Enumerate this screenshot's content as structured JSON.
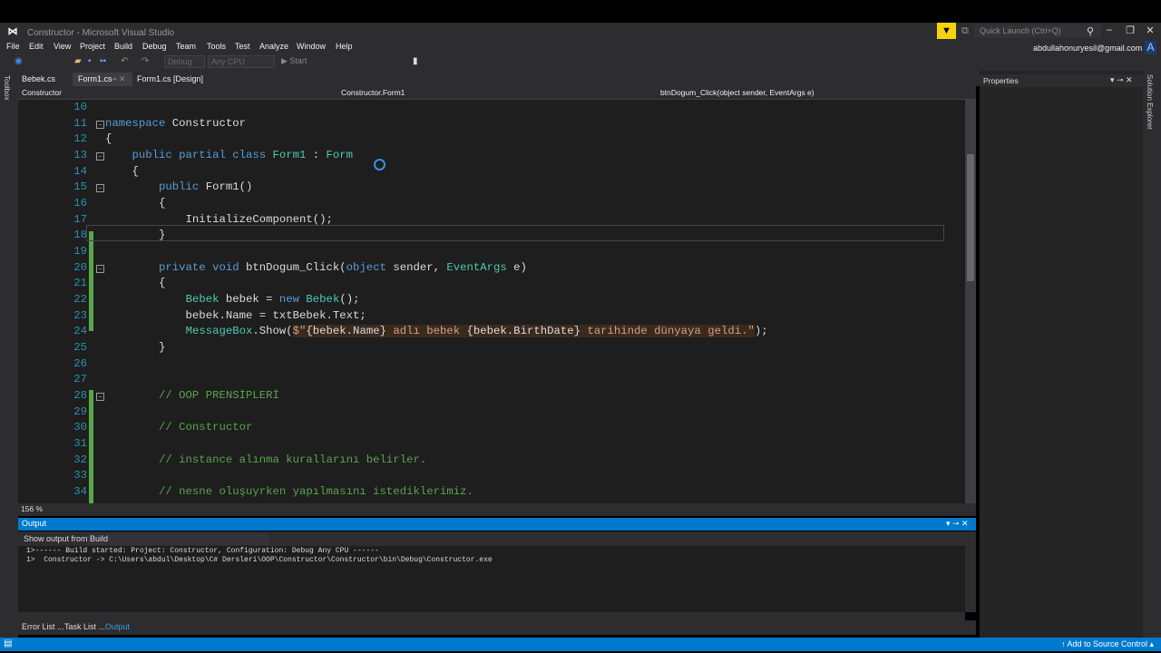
{
  "window": {
    "title": "Constructor - Microsoft Visual Studio",
    "quick_launch": "Quick Launch (Ctrl+Q)",
    "account": "abdullahonuryesil@gmail.com",
    "avatar": "A"
  },
  "menu": [
    "File",
    "Edit",
    "View",
    "Project",
    "Build",
    "Debug",
    "Team",
    "Tools",
    "Test",
    "Analyze",
    "Window",
    "Help"
  ],
  "toolbar": {
    "config": "Debug",
    "platform": "Any CPU",
    "start": "▶ Start"
  },
  "tabs": [
    "Bebek.cs",
    "Form1.cs",
    "Form1.cs [Design]"
  ],
  "nav": {
    "project": "Constructor",
    "class": "Constructor.Form1",
    "member": "btnDogum_Click(object sender, EventArgs e)"
  },
  "side": {
    "toolbox": "Toolbox",
    "solution": "Solution Explorer"
  },
  "editor": {
    "zoom": "156 %",
    "lines": [
      {
        "n": "10",
        "t": []
      },
      {
        "n": "11",
        "t": [
          [
            "namespace ",
            "kw"
          ],
          [
            "Constructor",
            ""
          ]
        ]
      },
      {
        "n": "12",
        "t": [
          [
            "{",
            ""
          ]
        ]
      },
      {
        "n": "13",
        "t": [
          [
            "    public partial class ",
            "kw"
          ],
          [
            "Form1",
            "ty"
          ],
          [
            " : ",
            ""
          ],
          [
            "Form",
            "ty"
          ]
        ]
      },
      {
        "n": "14",
        "t": [
          [
            "    {",
            ""
          ]
        ]
      },
      {
        "n": "15",
        "t": [
          [
            "        public ",
            "kw"
          ],
          [
            "Form1()",
            ""
          ]
        ]
      },
      {
        "n": "16",
        "t": [
          [
            "        {",
            ""
          ]
        ]
      },
      {
        "n": "17",
        "t": [
          [
            "            InitializeComponent();",
            ""
          ]
        ]
      },
      {
        "n": "18",
        "t": [
          [
            "        }",
            ""
          ]
        ]
      },
      {
        "n": "19",
        "t": []
      },
      {
        "n": "20",
        "t": [
          [
            "        private void ",
            "kw"
          ],
          [
            "btnDogum_Click(",
            ""
          ],
          [
            "object",
            "kw"
          ],
          [
            " sender, ",
            ""
          ],
          [
            "EventArgs",
            "ty"
          ],
          [
            " e)",
            ""
          ]
        ]
      },
      {
        "n": "21",
        "t": [
          [
            "        {",
            ""
          ]
        ]
      },
      {
        "n": "22",
        "t": [
          [
            "            ",
            ""
          ],
          [
            "Bebek",
            "ty"
          ],
          [
            " bebek = ",
            ""
          ],
          [
            "new ",
            "kw"
          ],
          [
            "Bebek",
            "ty"
          ],
          [
            "();",
            ""
          ]
        ]
      },
      {
        "n": "23",
        "t": [
          [
            "            bebek.Name = txtBebek.Text;",
            ""
          ]
        ]
      },
      {
        "n": "24",
        "t": [
          [
            "            ",
            ""
          ],
          [
            "MessageBox",
            "ty"
          ],
          [
            ".Show(",
            ""
          ],
          [
            "$\"",
            "st sthl"
          ],
          [
            "{bebek.Name}",
            "sthl"
          ],
          [
            " adlı bebek ",
            "st sthl"
          ],
          [
            "{bebek.BirthDate}",
            "sthl"
          ],
          [
            " tarihinde dünyaya geldi.\"",
            "st sthl"
          ],
          [
            ");",
            ""
          ]
        ]
      },
      {
        "n": "25",
        "t": [
          [
            "        }",
            ""
          ]
        ]
      },
      {
        "n": "26",
        "t": []
      },
      {
        "n": "27",
        "t": []
      },
      {
        "n": "28",
        "t": [
          [
            "        // OOP PRENSİPLERİ",
            "cm"
          ]
        ]
      },
      {
        "n": "29",
        "t": []
      },
      {
        "n": "30",
        "t": [
          [
            "        // Constructor",
            "cm"
          ]
        ]
      },
      {
        "n": "31",
        "t": []
      },
      {
        "n": "32",
        "t": [
          [
            "        // instance alınma kurallarını belirler.",
            "cm"
          ]
        ]
      },
      {
        "n": "33",
        "t": []
      },
      {
        "n": "34",
        "t": [
          [
            "        // nesne oluşuyrken yapılmasını istediklerimiz.",
            "cm"
          ]
        ]
      }
    ]
  },
  "output": {
    "title": "Output",
    "show_from_label": "Show output from:",
    "source": "Build",
    "lines": [
      "1>------ Build started: Project: Constructor, Configuration: Debug Any CPU ------",
      "1>  Constructor -> C:\\Users\\abdul\\Desktop\\C# Dersleri\\OOP\\Constructor\\Constructor\\bin\\Debug\\Constructor.exe"
    ]
  },
  "bottom_tabs": [
    "Error List ...",
    "Task List ...",
    "Output"
  ],
  "properties": {
    "title": "Properties"
  },
  "status": {
    "source_control": "↑ Add to Source Control ▴"
  }
}
